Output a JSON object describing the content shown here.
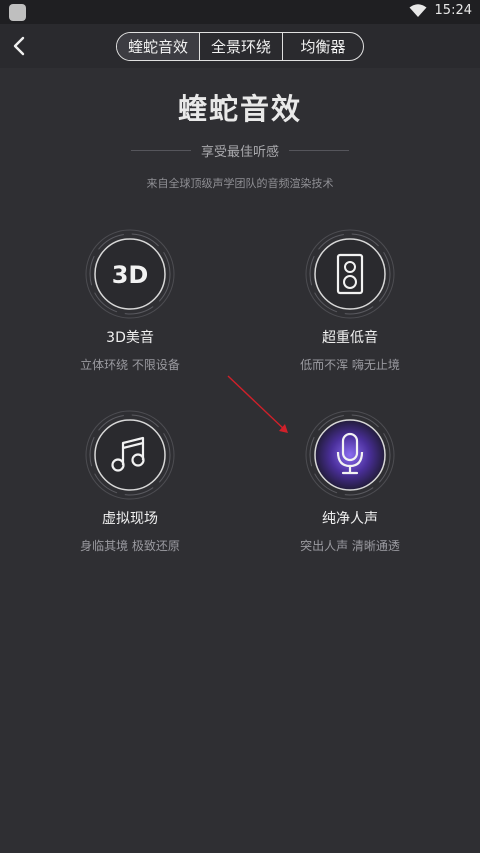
{
  "status_bar": {
    "time": "15:24"
  },
  "header": {
    "tabs": [
      {
        "label": "蝰蛇音效",
        "active": true
      },
      {
        "label": "全景环绕",
        "active": false
      },
      {
        "label": "均衡器",
        "active": false
      }
    ]
  },
  "hero": {
    "title": "蝰蛇音效",
    "subtitle": "享受最佳听感",
    "description": "来自全球顶级声学团队的音频渲染技术"
  },
  "features": [
    {
      "icon": "3d-icon",
      "icon_text": "3D",
      "name": "3D美音",
      "desc": "立体环绕 不限设备"
    },
    {
      "icon": "speaker-icon",
      "name": "超重低音",
      "desc": "低而不浑 嗨无止境"
    },
    {
      "icon": "music-note-icon",
      "name": "虚拟现场",
      "desc": "身临其境 极致还原"
    },
    {
      "icon": "microphone-icon",
      "name": "纯净人声",
      "desc": "突出人声 清晰通透"
    }
  ],
  "colors": {
    "background": "#2f2f33",
    "accent_glow": "#6a4cc9",
    "annotation_arrow": "#d0202a"
  }
}
